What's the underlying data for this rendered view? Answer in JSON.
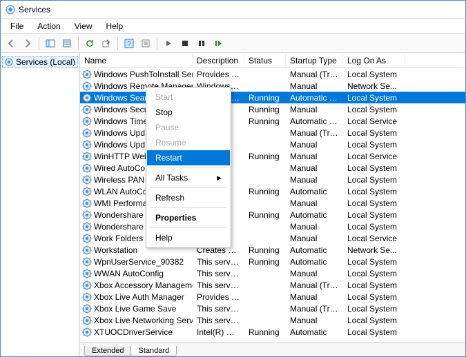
{
  "window": {
    "title": "Services"
  },
  "menubar": [
    "File",
    "Action",
    "View",
    "Help"
  ],
  "tree": {
    "root": "Services (Local)"
  },
  "columns": [
    "Name",
    "Description",
    "Status",
    "Startup Type",
    "Log On As"
  ],
  "context_menu": {
    "items": [
      {
        "label": "Start",
        "state": "disabled"
      },
      {
        "label": "Stop",
        "state": ""
      },
      {
        "label": "Pause",
        "state": "disabled"
      },
      {
        "label": "Resume",
        "state": "disabled"
      },
      {
        "label": "Restart",
        "state": "highlight"
      },
      {
        "sep": true
      },
      {
        "label": "All Tasks",
        "state": "",
        "submenu": true
      },
      {
        "sep": true
      },
      {
        "label": "Refresh",
        "state": ""
      },
      {
        "sep": true
      },
      {
        "label": "Properties",
        "state": "bold"
      },
      {
        "sep": true
      },
      {
        "label": "Help",
        "state": ""
      }
    ]
  },
  "tabs": {
    "a": "Extended",
    "b": "Standard"
  },
  "services": [
    {
      "name": "Windows PushToInstall Servi...",
      "desc": "Provides infr...",
      "status": "",
      "startup": "Manual (Trigg...",
      "logon": "Local System"
    },
    {
      "name": "Windows Remote Managem...",
      "desc": "Windows Re...",
      "status": "",
      "startup": "Manual",
      "logon": "Network Se..."
    },
    {
      "name": "Windows Search",
      "desc": "Provides con...",
      "status": "Running",
      "startup": "Automatic (De...",
      "logon": "Local System",
      "selected": true
    },
    {
      "name": "Windows Secu",
      "desc": "e...",
      "status": "Running",
      "startup": "Manual",
      "logon": "Local System"
    },
    {
      "name": "Windows Time",
      "desc": "l...",
      "status": "Running",
      "startup": "Automatic (De...",
      "logon": "Local Service"
    },
    {
      "name": "Windows Upd",
      "desc": "...",
      "status": "",
      "startup": "Manual (Trigg...",
      "logon": "Local System"
    },
    {
      "name": "Windows Upd",
      "desc": "",
      "status": "",
      "startup": "Manual",
      "logon": "Local System"
    },
    {
      "name": "WinHTTP Web",
      "desc": "n...",
      "status": "Running",
      "startup": "Manual",
      "logon": "Local Service"
    },
    {
      "name": "Wired AutoCo",
      "desc": "",
      "status": "",
      "startup": "Manual",
      "logon": "Local System"
    },
    {
      "name": "Wireless PAN D",
      "desc": "",
      "status": "",
      "startup": "Manual",
      "logon": "Local System"
    },
    {
      "name": "WLAN AutoCo",
      "desc": "...",
      "status": "Running",
      "startup": "Automatic",
      "logon": "Local System"
    },
    {
      "name": "WMI Performa",
      "desc": "...",
      "status": "",
      "startup": "Manual",
      "logon": "Local System"
    },
    {
      "name": "Wondershare",
      "desc": "r",
      "status": "Running",
      "startup": "Automatic",
      "logon": "Local System"
    },
    {
      "name": "Wondershare",
      "desc": "...",
      "status": "",
      "startup": "Manual",
      "logon": "Local System"
    },
    {
      "name": "Work Folders",
      "desc": "...",
      "status": "",
      "startup": "Manual",
      "logon": "Local Service"
    },
    {
      "name": "Workstation",
      "desc": "Creates and ...",
      "status": "Running",
      "startup": "Automatic",
      "logon": "Network Se..."
    },
    {
      "name": "WpnUserService_90382",
      "desc": "This service ...",
      "status": "Running",
      "startup": "Automatic",
      "logon": "Local System"
    },
    {
      "name": "WWAN AutoConfig",
      "desc": "This service ...",
      "status": "",
      "startup": "Manual",
      "logon": "Local System"
    },
    {
      "name": "Xbox Accessory Managemen...",
      "desc": "This service ...",
      "status": "",
      "startup": "Manual (Trigg...",
      "logon": "Local System"
    },
    {
      "name": "Xbox Live Auth Manager",
      "desc": "Provides aut...",
      "status": "",
      "startup": "Manual",
      "logon": "Local System"
    },
    {
      "name": "Xbox Live Game Save",
      "desc": "This service ...",
      "status": "",
      "startup": "Manual (Trigg...",
      "logon": "Local System"
    },
    {
      "name": "Xbox Live Networking Service",
      "desc": "This service ...",
      "status": "",
      "startup": "Manual",
      "logon": "Local System"
    },
    {
      "name": "XTUOCDriverService",
      "desc": "Intel(R) Over...",
      "status": "Running",
      "startup": "Automatic",
      "logon": "Local System"
    }
  ]
}
